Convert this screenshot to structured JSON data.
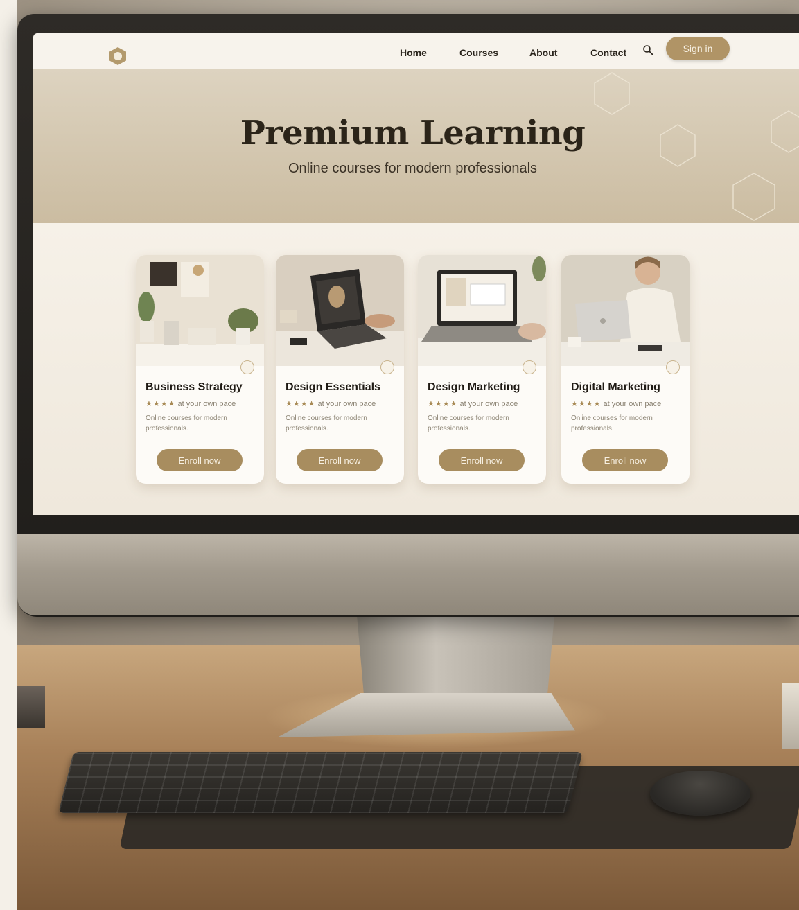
{
  "nav": {
    "links": [
      "Home",
      "Courses",
      "About",
      "Contact"
    ],
    "signin_label": "Sign in"
  },
  "hero": {
    "title": "Premium Learning",
    "subtitle": "Online courses for modern professionals"
  },
  "cards": [
    {
      "title": "Business Strategy",
      "stars": "★★★★",
      "rating_text": "at your own pace",
      "description": "Online courses for modern professionals.",
      "button": "Enroll now",
      "image": "office-desk-plants-image"
    },
    {
      "title": "Design Essentials",
      "stars": "★★★★",
      "rating_text": "at your own pace",
      "description": "Online courses for modern professionals.",
      "button": "Enroll now",
      "image": "laptop-typing-image"
    },
    {
      "title": "Design Marketing",
      "stars": "★★★★",
      "rating_text": "at your own pace",
      "description": "Online courses for modern professionals.",
      "button": "Enroll now",
      "image": "laptop-screen-image"
    },
    {
      "title": "Digital Marketing",
      "stars": "★★★★",
      "rating_text": "at your own pace",
      "description": "Online courses for modern professionals.",
      "button": "Enroll now",
      "image": "woman-laptop-image"
    }
  ],
  "colors": {
    "accent": "#a88d5f",
    "hero_bg": "#d6cab4",
    "page_bg": "#f5f0e7",
    "text_dark": "#2b2419"
  }
}
